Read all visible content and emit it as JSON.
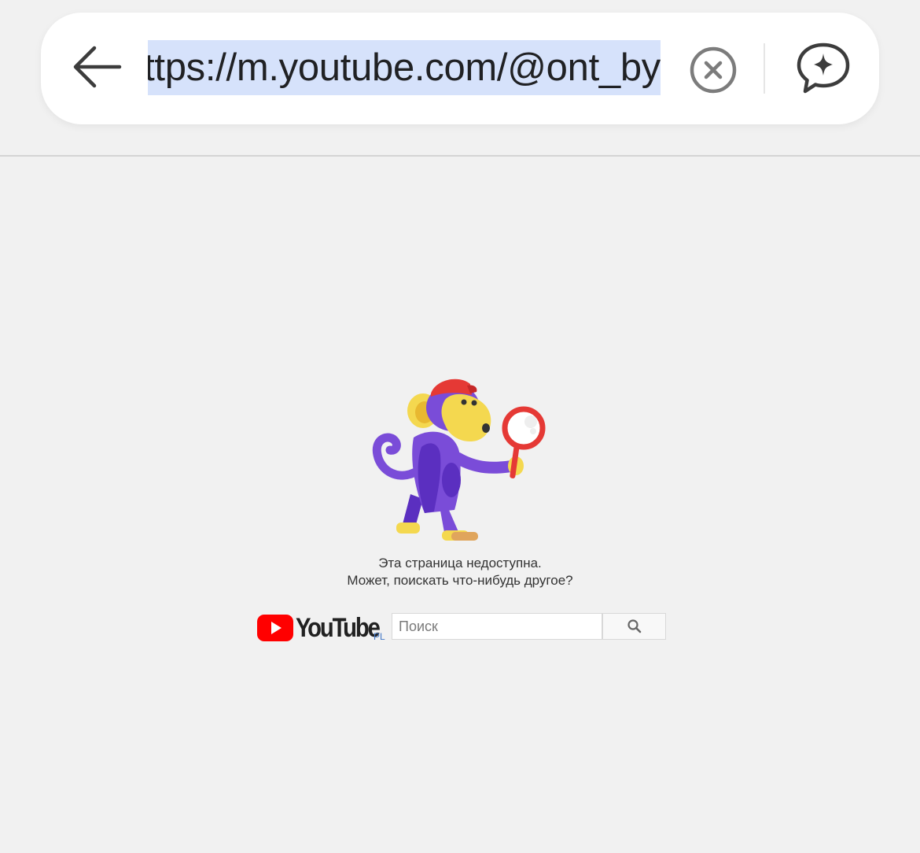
{
  "browser": {
    "url": "https://m.youtube.com/@ont_by",
    "back_icon": "arrow-left-icon",
    "clear_icon": "close-circle-icon",
    "assistant_icon": "sparkle-chat-icon",
    "selection_color": "#d6e2fb"
  },
  "error_page": {
    "illustration": "monkey-with-magnifier",
    "message_line1": "Эта страница недоступна.",
    "message_line2": "Может, поискать что-нибудь другое?",
    "logo_text": "YouTube",
    "logo_country": "PL",
    "search_placeholder": "Поиск",
    "search_icon": "search-icon",
    "brand_red": "#ff0000"
  }
}
